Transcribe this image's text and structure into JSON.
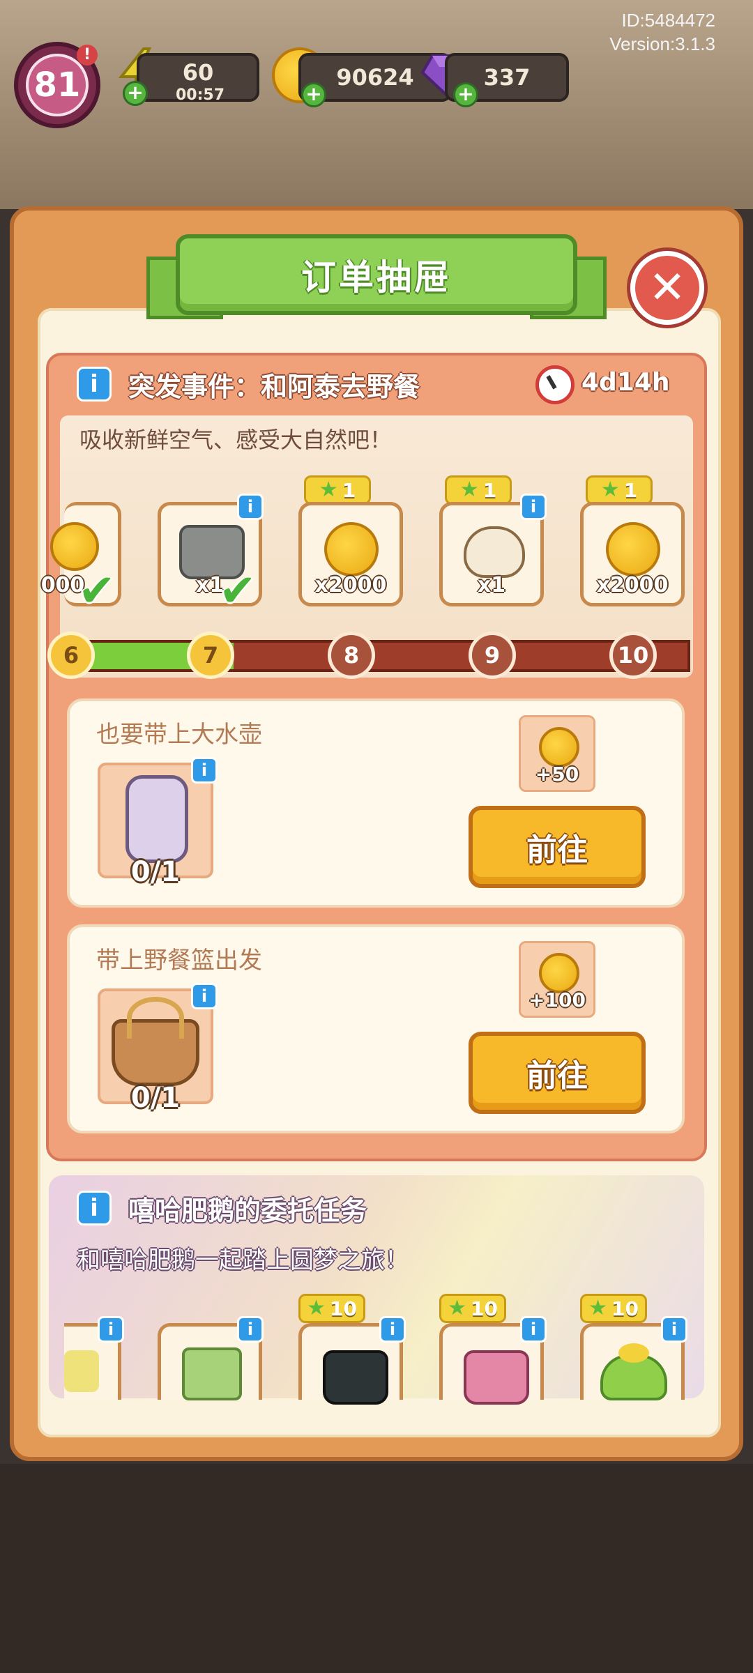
{
  "system": {
    "id": "ID:5484472",
    "version": "Version:3.1.3"
  },
  "hud": {
    "level": "81",
    "level_badge_dot": "!",
    "energy": "60",
    "energy_timer": "00:57",
    "coins": "90624",
    "gems": "337",
    "plus": "+"
  },
  "modal": {
    "title": "订单抽屉",
    "close_symbol": "✕"
  },
  "event": {
    "title": "突发事件：和阿泰去野餐",
    "timer": "4d14h",
    "subtitle": "吸收新鲜空气、感受大自然吧！",
    "info": "i",
    "rewards": [
      {
        "count": "000",
        "star": "",
        "step": "6",
        "done": true
      },
      {
        "count": "x1",
        "star": "",
        "step": "7",
        "done": true
      },
      {
        "count": "x2000",
        "star": "1",
        "step": "8",
        "done": false
      },
      {
        "count": "x1",
        "star": "1",
        "step": "9",
        "done": false
      },
      {
        "count": "x2000",
        "star": "1",
        "step": "10",
        "done": false
      }
    ],
    "progress_fraction": 0.27
  },
  "tasks": [
    {
      "title": "也要带上大水壶",
      "progress": "0/1",
      "reward": "+50",
      "button": "前往"
    },
    {
      "title": "带上野餐篮出发",
      "progress": "0/1",
      "reward": "+100",
      "button": "前往"
    }
  ],
  "commission": {
    "title": "嘻哈肥鹅的委托任务",
    "subtitle": "和嘻哈肥鹅一起踏上圆梦之旅！",
    "tags": [
      "10",
      "10",
      "10"
    ]
  },
  "colors": {
    "panel": "#e39a56",
    "ribbon": "#8fd056",
    "button": "#f7b92a",
    "close": "#e25a4e"
  }
}
